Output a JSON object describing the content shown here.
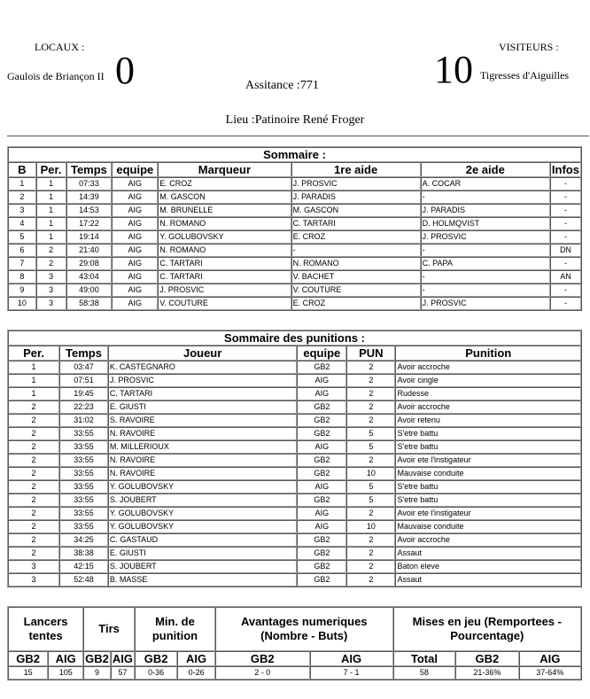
{
  "header": {
    "home_label": "LOCAUX :",
    "home_team": "Gaulois de Briançon II",
    "home_score": "0",
    "away_label": "VISITEURS :",
    "away_team": "Tigresses d'Aiguilles",
    "away_score": "10",
    "attendance": "Assitance :771",
    "venue": "Lieu :Patinoire René Froger"
  },
  "goals": {
    "title": "Sommaire :",
    "columns": [
      "B",
      "Per.",
      "Temps",
      "equipe",
      "Marqueur",
      "1re aide",
      "2e aide",
      "Infos"
    ],
    "rows": [
      [
        "1",
        "1",
        "07:33",
        "AIG",
        "E. CROZ",
        "J. PROSVIC",
        "A. COCAR",
        "-"
      ],
      [
        "2",
        "1",
        "14:39",
        "AIG",
        "M. GASCON",
        "J. PARADIS",
        "-",
        "-"
      ],
      [
        "3",
        "1",
        "14:53",
        "AIG",
        "M. BRUNELLE",
        "M. GASCON",
        "J. PARADIS",
        "-"
      ],
      [
        "4",
        "1",
        "17:22",
        "AIG",
        "N. ROMANO",
        "C. TARTARI",
        "D. HOLMQVIST",
        "-"
      ],
      [
        "5",
        "1",
        "19:14",
        "AIG",
        "Y. GOLUBOVSKY",
        "E. CROZ",
        "J. PROSVIC",
        "-"
      ],
      [
        "6",
        "2",
        "21:40",
        "AIG",
        "N. ROMANO",
        "-",
        "-",
        "DN"
      ],
      [
        "7",
        "2",
        "29:08",
        "AIG",
        "C. TARTARI",
        "N. ROMANO",
        "C. PAPA",
        "-"
      ],
      [
        "8",
        "3",
        "43:04",
        "AIG",
        "C. TARTARI",
        "V. BACHET",
        "-",
        "AN"
      ],
      [
        "9",
        "3",
        "49:00",
        "AIG",
        "J. PROSVIC",
        "V. COUTURE",
        "-",
        "-"
      ],
      [
        "10",
        "3",
        "58:38",
        "AIG",
        "V. COUTURE",
        "E. CROZ",
        "J. PROSVIC",
        "-"
      ]
    ]
  },
  "penalties": {
    "title": "Sommaire des punitions :",
    "columns": [
      "Per.",
      "Temps",
      "Joueur",
      "equipe",
      "PUN",
      "Punition"
    ],
    "rows": [
      [
        "1",
        "03:47",
        "K. CASTEGNARO",
        "GB2",
        "2",
        "Avoir accroche"
      ],
      [
        "1",
        "07:51",
        "J. PROSVIC",
        "AIG",
        "2",
        "Avoir cingle"
      ],
      [
        "1",
        "19:45",
        "C. TARTARI",
        "AIG",
        "2",
        "Rudesse"
      ],
      [
        "2",
        "22:23",
        "E. GIUSTI",
        "GB2",
        "2",
        "Avoir accroche"
      ],
      [
        "2",
        "31:02",
        "S. RAVOIRE",
        "GB2",
        "2",
        "Avoir retenu"
      ],
      [
        "2",
        "33:55",
        "N. RAVOIRE",
        "GB2",
        "5",
        "S'etre battu"
      ],
      [
        "2",
        "33:55",
        "M. MILLERIOUX",
        "AIG",
        "5",
        "S'etre battu"
      ],
      [
        "2",
        "33:55",
        "N. RAVOIRE",
        "GB2",
        "2",
        "Avoir ete l'instigateur"
      ],
      [
        "2",
        "33:55",
        "N. RAVOIRE",
        "GB2",
        "10",
        "Mauvaise conduite"
      ],
      [
        "2",
        "33:55",
        "Y. GOLUBOVSKY",
        "AIG",
        "5",
        "S'etre battu"
      ],
      [
        "2",
        "33:55",
        "S. JOUBERT",
        "GB2",
        "5",
        "S'etre battu"
      ],
      [
        "2",
        "33:55",
        "Y. GOLUBOVSKY",
        "AIG",
        "2",
        "Avoir ete l'instigateur"
      ],
      [
        "2",
        "33:55",
        "Y. GOLUBOVSKY",
        "AIG",
        "10",
        "Mauvaise conduite"
      ],
      [
        "2",
        "34:25",
        "C. GASTAUD",
        "GB2",
        "2",
        "Avoir accroche"
      ],
      [
        "2",
        "38:38",
        "E. GIUSTI",
        "GB2",
        "2",
        "Assaut"
      ],
      [
        "3",
        "42:15",
        "S. JOUBERT",
        "GB2",
        "2",
        "Baton eleve"
      ],
      [
        "3",
        "52:48",
        "B. MASSE",
        "GB2",
        "2",
        "Assaut"
      ]
    ]
  },
  "stats": {
    "groups": [
      {
        "label": "Lancers tentes",
        "sub": [
          "GB2",
          "AIG"
        ],
        "values": [
          "15",
          "105"
        ]
      },
      {
        "label": "Tirs",
        "sub": [
          "GB2",
          "AIG"
        ],
        "values": [
          "9",
          "57"
        ]
      },
      {
        "label": "Min. de punition",
        "sub": [
          "GB2",
          "AIG"
        ],
        "values": [
          "0-36",
          "0-26"
        ]
      },
      {
        "label": "Avantages numeriques (Nombre - Buts)",
        "sub": [
          "GB2",
          "AIG"
        ],
        "values": [
          "2 - 0",
          "7 - 1"
        ]
      },
      {
        "label": "Mises en jeu (Remportees - Pourcentage)",
        "sub": [
          "Total",
          "GB2",
          "AIG"
        ],
        "values": [
          "58",
          "21-36%",
          "37-64%"
        ]
      }
    ]
  }
}
